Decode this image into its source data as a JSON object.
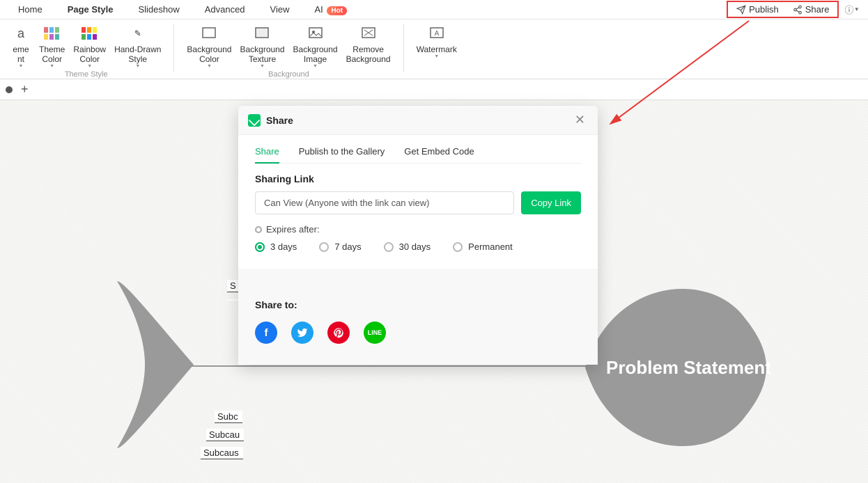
{
  "menubar": {
    "tabs": [
      "Home",
      "Page Style",
      "Slideshow",
      "Advanced",
      "View",
      "AI"
    ],
    "active_index": 1,
    "hot_label": "Hot"
  },
  "topright": {
    "publish": "Publish",
    "share": "Share"
  },
  "ribbon": {
    "theme_style_group": "Theme Style",
    "background_group": "Background",
    "items": {
      "theme_font": "eme\nnt",
      "theme_color": "Theme\nColor",
      "rainbow_color": "Rainbow\nColor",
      "hand_drawn": "Hand-Drawn\nStyle",
      "bg_color": "Background\nColor",
      "bg_texture": "Background\nTexture",
      "bg_image": "Background\nImage",
      "remove_bg": "Remove\nBackground",
      "watermark": "Watermark"
    }
  },
  "diagram": {
    "head_text": "Problem Statement",
    "sub1": "S",
    "sub2": "Subc",
    "sub3": "Subcau",
    "sub4": "Subcaus"
  },
  "dialog": {
    "title": "Share",
    "tabs": [
      "Share",
      "Publish to the Gallery",
      "Get Embed Code"
    ],
    "active_tab": 0,
    "section_link": "Sharing Link",
    "link_value": "Can View (Anyone with the link can view)",
    "copy_btn": "Copy Link",
    "expires_label": "Expires after:",
    "radio_options": [
      "3 days",
      "7 days",
      "30 days",
      "Permanent"
    ],
    "radio_selected": 0,
    "share_to": "Share to:"
  }
}
